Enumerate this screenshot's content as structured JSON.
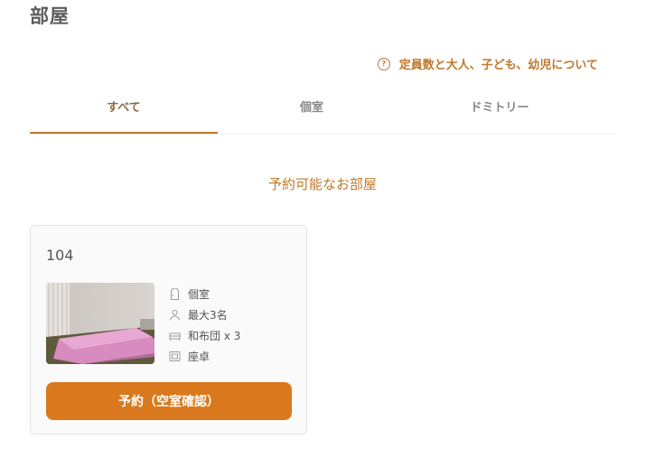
{
  "page": {
    "title": "部屋"
  },
  "capacity_link": {
    "label": "定員数と大人、子ども、幼児について",
    "icon": "help-circle-icon"
  },
  "tabs": [
    {
      "label": "すべて",
      "active": true
    },
    {
      "label": "個室",
      "active": false
    },
    {
      "label": "ドミトリー",
      "active": false
    }
  ],
  "section": {
    "heading": "予約可能なお部屋"
  },
  "room": {
    "number": "104",
    "features": [
      {
        "icon": "door-icon",
        "label": "個室"
      },
      {
        "icon": "person-icon",
        "label": "最大3名"
      },
      {
        "icon": "bed-icon",
        "label": "和布団 x 3"
      },
      {
        "icon": "table-icon",
        "label": "座卓"
      }
    ],
    "reserve_label": "予約（空室確認）"
  },
  "colors": {
    "accent": "#c0782a",
    "button": "#d9781c",
    "text": "#555555"
  }
}
